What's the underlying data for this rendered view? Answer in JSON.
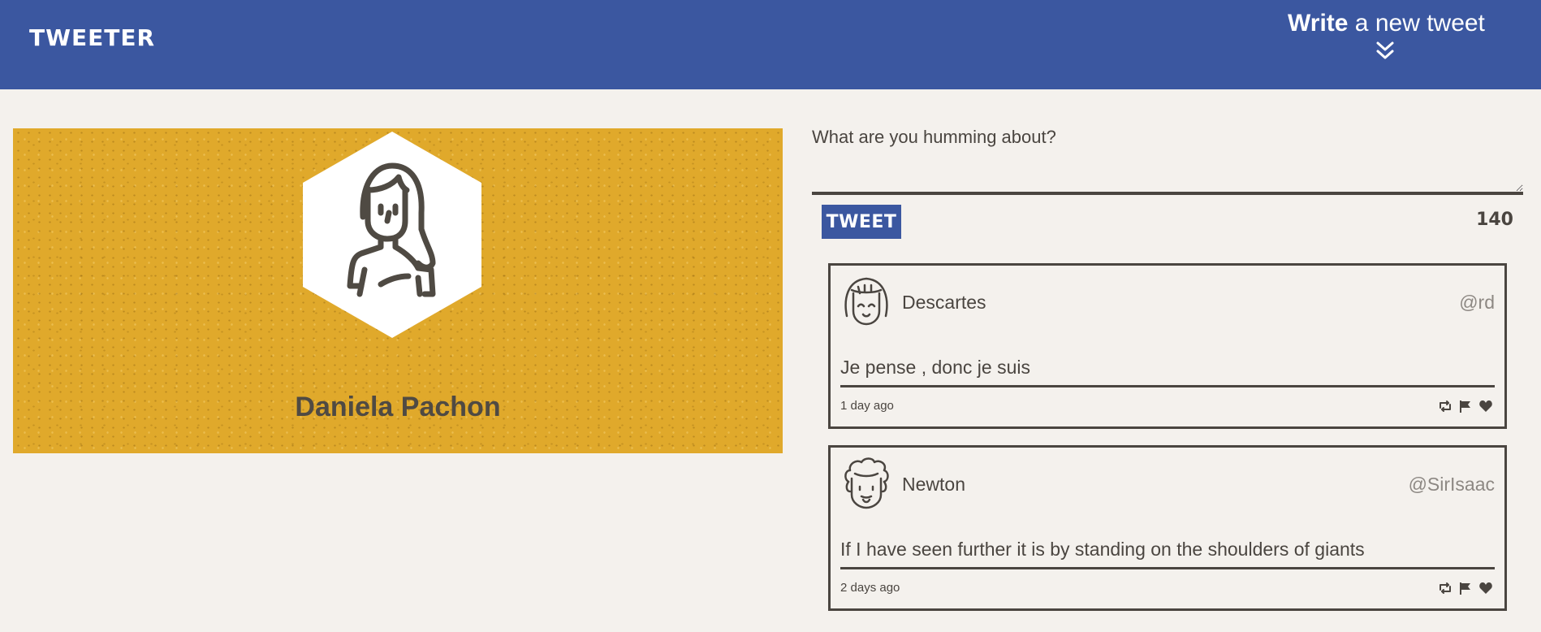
{
  "header": {
    "logo": "TWEETER",
    "compose_bold": "Write",
    "compose_rest": " a new tweet"
  },
  "profile": {
    "name": "Daniela Pachon"
  },
  "composer": {
    "placeholder": "What are you humming about?",
    "button_label": "TWEET",
    "counter": "140"
  },
  "tweets": [
    {
      "name": "Descartes",
      "handle": "@rd",
      "text": "Je pense , donc je suis",
      "time": "1 day ago"
    },
    {
      "name": "Newton",
      "handle": "@SirIsaac",
      "text": "If I have seen further it is by standing on the shoulders of giants",
      "time": "2 days ago"
    }
  ],
  "icons": {
    "compose_toggle": "double-chevron-down-icon",
    "retweet": "retweet-icon",
    "flag": "flag-icon",
    "like": "heart-icon"
  },
  "colors": {
    "header_bg": "#3b57a0",
    "page_bg": "#f4f1ed",
    "profile_bg": "#e0a92b",
    "text": "#4a4540",
    "muted": "#8d8883"
  }
}
